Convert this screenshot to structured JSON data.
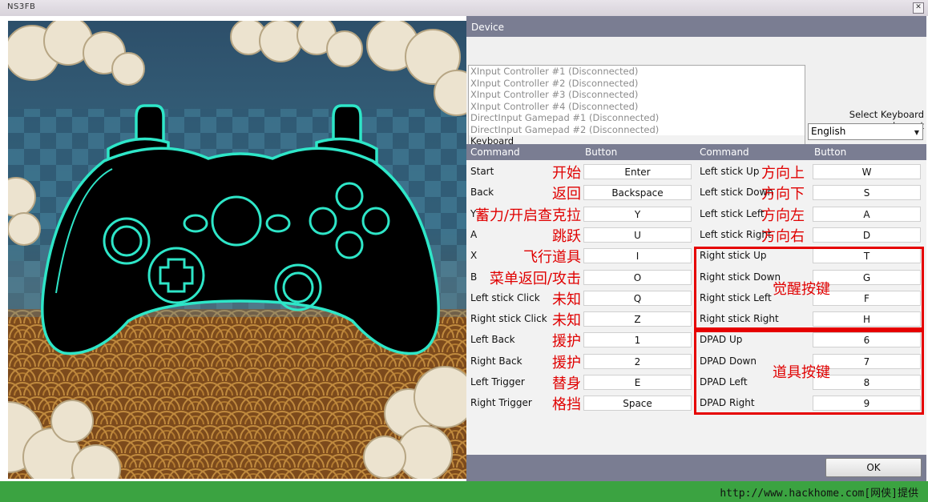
{
  "window": {
    "title": "NS3FB",
    "close_symbol": "✕"
  },
  "device": {
    "header": "Device",
    "items": [
      "XInput Controller #1 (Disconnected)",
      "XInput Controller #2 (Disconnected)",
      "XInput Controller #3 (Disconnected)",
      "XInput Controller #4 (Disconnected)",
      "DirectInput Gamepad #1 (Disconnected)",
      "DirectInput Gamepad #2 (Disconnected)",
      "Keyboard"
    ],
    "selected_index": 6
  },
  "keyboard_layout": {
    "label": "Select Keyboard Layout",
    "selected": "English"
  },
  "table": {
    "headers": {
      "command": "Command",
      "button": "Button"
    },
    "left": [
      {
        "command": "Start",
        "key": "Enter",
        "note": "开始"
      },
      {
        "command": "Back",
        "key": "Backspace",
        "note": "返回"
      },
      {
        "command": "Y",
        "key": "Y",
        "note": "蓄力/开启查克拉"
      },
      {
        "command": "A",
        "key": "U",
        "note": "跳跃"
      },
      {
        "command": "X",
        "key": "I",
        "note": "飞行道具"
      },
      {
        "command": "B",
        "key": "O",
        "note": "菜单返回/攻击"
      },
      {
        "command": "Left stick Click",
        "key": "Q",
        "note": "未知"
      },
      {
        "command": "Right stick Click",
        "key": "Z",
        "note": "未知"
      },
      {
        "command": "Left Back",
        "key": "1",
        "note": "援护"
      },
      {
        "command": "Right Back",
        "key": "2",
        "note": "援护"
      },
      {
        "command": "Left Trigger",
        "key": "E",
        "note": "替身"
      },
      {
        "command": "Right Trigger",
        "key": "Space",
        "note": "格挡"
      }
    ],
    "right": [
      {
        "command": "Left stick Up",
        "key": "W",
        "note": "方向上"
      },
      {
        "command": "Left stick Down",
        "key": "S",
        "note": "方向下"
      },
      {
        "command": "Left stick Left",
        "key": "A",
        "note": "方向左"
      },
      {
        "command": "Left stick Right",
        "key": "D",
        "note": "方向右"
      },
      {
        "command": "Right stick Up",
        "key": "T",
        "note": ""
      },
      {
        "command": "Right stick Down",
        "key": "G",
        "note": ""
      },
      {
        "command": "Right stick Left",
        "key": "F",
        "note": ""
      },
      {
        "command": "Right stick Right",
        "key": "H",
        "note": ""
      },
      {
        "command": "DPAD Up",
        "key": "6",
        "note": ""
      },
      {
        "command": "DPAD Down",
        "key": "7",
        "note": ""
      },
      {
        "command": "DPAD Left",
        "key": "8",
        "note": ""
      },
      {
        "command": "DPAD Right",
        "key": "9",
        "note": ""
      }
    ],
    "group_notes": {
      "right_stick": "觉醒按键",
      "dpad": "道具按键"
    }
  },
  "ok_button": "OK",
  "footer": "http://www.hackhome.com[网侠]提供",
  "colors": {
    "header_bar": "#7a7d92",
    "glow": "#2ee6c8",
    "annotation": "#e60000",
    "footer": "#3ba341"
  }
}
